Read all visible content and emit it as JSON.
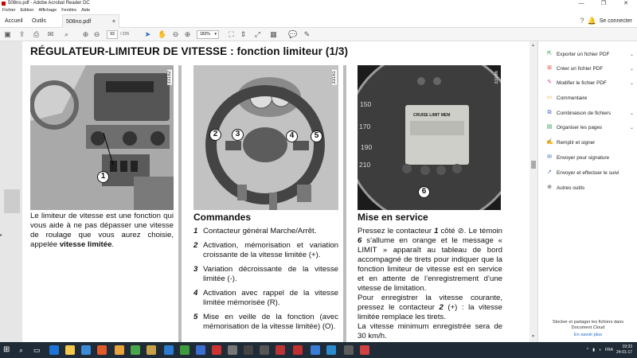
{
  "window": {
    "title": "508no.pdf - Adobe Acrobat Reader DC",
    "minimize": "—",
    "maximize": "❐",
    "close": "✕"
  },
  "menu": [
    "Fichier",
    "Edition",
    "Affichage",
    "Fenêtre",
    "Aide"
  ],
  "tabs": {
    "home": "Accueil",
    "tools": "Outils",
    "doc": "508no.pdf",
    "close": "×"
  },
  "signin": "Se connecter",
  "toolbar": {
    "page_current": "93",
    "page_total": "/ 226",
    "zoom": "182%"
  },
  "document": {
    "title": "RÉGULATEUR-LIMITEUR DE VITESSE : fonction limiteur (1/3)",
    "fig1": {
      "num": "33162",
      "callouts": [
        "1"
      ]
    },
    "fig2": {
      "num": "33161",
      "callouts": [
        "2",
        "3",
        "4",
        "5"
      ]
    },
    "fig3": {
      "num": "33166",
      "callouts": [
        "6"
      ],
      "speeds": [
        "150",
        "170",
        "190",
        "210"
      ],
      "display": "CRUISE  LIMIT  MEM"
    },
    "col1": {
      "text": "Le limiteur de vitesse est une fonction qui vous aide à ne pas dépasser une vitesse de roulage que vous aurez choisie, appelée ",
      "bold": "vitesse limitée",
      "end": "."
    },
    "col2": {
      "heading": "Commandes",
      "items": [
        {
          "n": "1",
          "text": "Contacteur général Marche/Arrêt."
        },
        {
          "n": "2",
          "text": "Activation, mémorisation et variation croissante de la vitesse limitée (+)."
        },
        {
          "n": "3",
          "text": "Variation décroissante de la vitesse limitée (-)."
        },
        {
          "n": "4",
          "text": "Activation avec rappel de la vitesse limitée mémorisée (R)."
        },
        {
          "n": "5",
          "text": "Mise en veille de la fonction (avec mémorisation de la vitesse limitée) (O)."
        }
      ]
    },
    "col3": {
      "heading": "Mise en service",
      "p1a": "Pressez le contacteur ",
      "p1n": "1",
      "p1b": " côté ",
      "p1c": ". Le témoin ",
      "p1n2": "6",
      "p1d": " s’allume en orange et le message « LIMIT » apparaît au tableau de bord accompagné de tirets pour indiquer que la fonction limiteur de vitesse est en service et en attente de l’enregistrement d’une vitesse de limitation.",
      "p2a": "Pour enregistrer la vitesse courante, pressez le contacteur ",
      "p2n": "2",
      "p2b": " (+) : la vitesse limitée remplace les tirets.",
      "p3": "La vitesse minimum enregistrée sera de 30 km/h."
    }
  },
  "rightpane": {
    "items": [
      {
        "label": "Exporter un fichier PDF",
        "icon": "export-icon",
        "color": "#2a9d4b",
        "chevron": true
      },
      {
        "label": "Créer un fichier PDF",
        "icon": "create-pdf-icon",
        "color": "#d94a3a",
        "chevron": true
      },
      {
        "label": "Modifier le fichier PDF",
        "icon": "edit-pdf-icon",
        "color": "#c2489b",
        "chevron": true
      },
      {
        "label": "Commentaire",
        "icon": "comment-icon",
        "color": "#f2a21b",
        "chevron": false
      },
      {
        "label": "Combinaison de fichiers",
        "icon": "combine-icon",
        "color": "#3b66c4",
        "chevron": true
      },
      {
        "label": "Organiser les pages",
        "icon": "organize-icon",
        "color": "#2a9d4b",
        "chevron": true
      },
      {
        "label": "Remplir et signer",
        "icon": "fill-sign-icon",
        "color": "#7a45b8",
        "chevron": false
      },
      {
        "label": "Envoyer pour signature",
        "icon": "send-sign-icon",
        "color": "#3b66c4",
        "chevron": false
      },
      {
        "label": "Envoyer et effectuer le suivi",
        "icon": "send-track-icon",
        "color": "#3b66c4",
        "chevron": false
      },
      {
        "label": "Autres outils",
        "icon": "more-tools-icon",
        "color": "#555555",
        "chevron": false
      }
    ],
    "promo": "Stocker et partager les fichiers dans Document Cloud",
    "link": "En savoir plus"
  },
  "taskbar": {
    "lang": "FRA",
    "time": "19:33",
    "date": "24-01-17"
  }
}
